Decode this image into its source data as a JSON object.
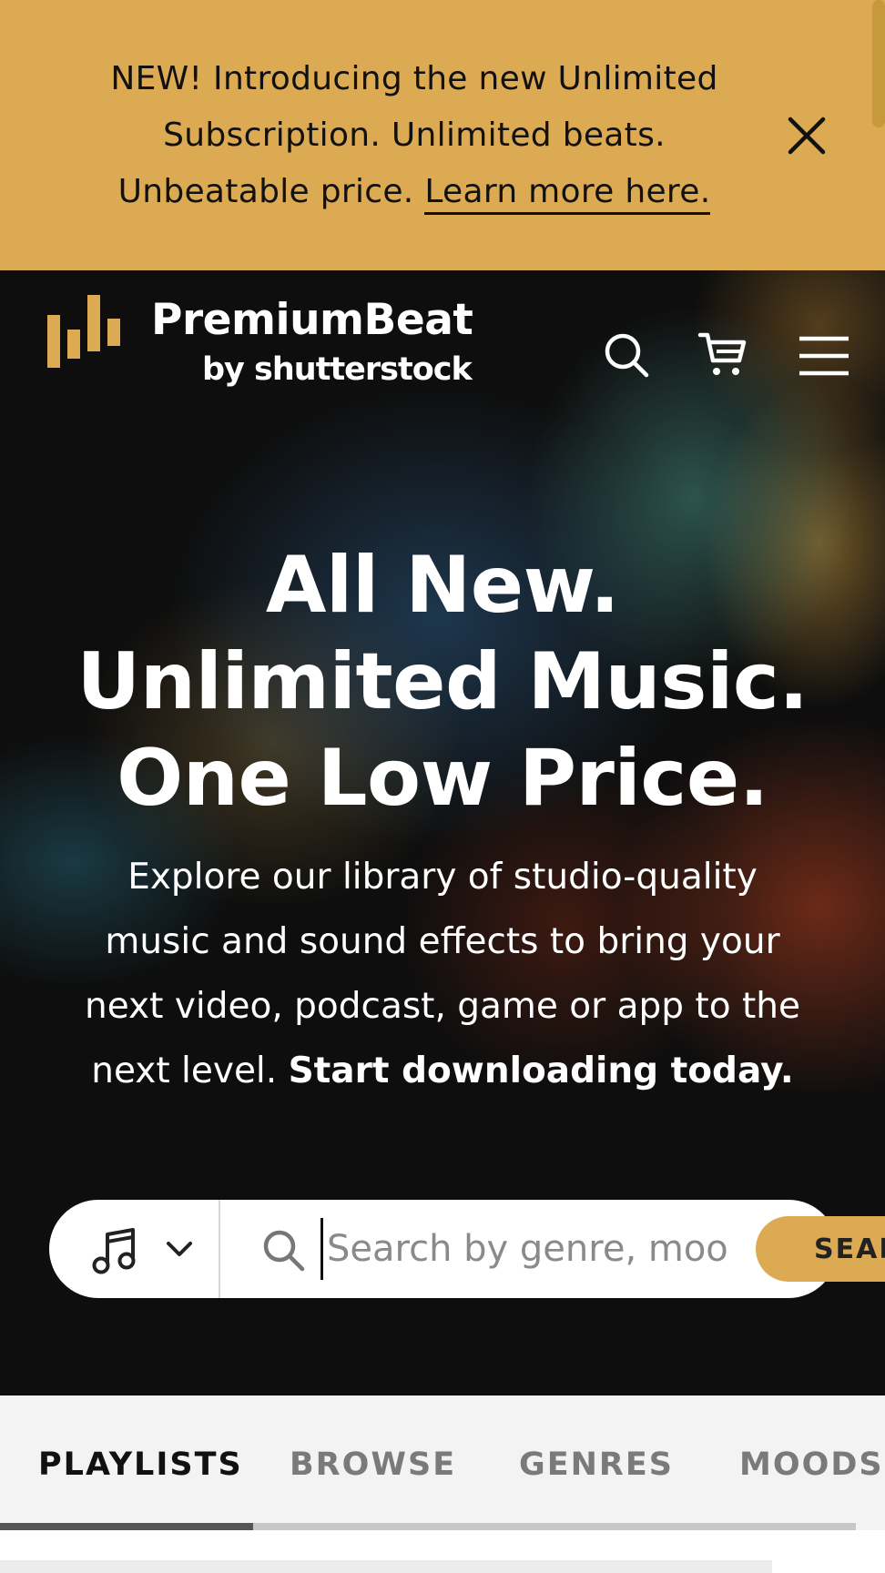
{
  "banner": {
    "text_line1": "NEW! Introducing the new Unlimited",
    "text_line2": "Subscription. Unlimited beats.",
    "text_line3_prefix": "Unbeatable price.",
    "link_label": "Learn more here.",
    "close_icon": "close-icon",
    "background": "#dcaa52"
  },
  "header": {
    "logo_main": "PremiumBeat",
    "logo_sub": "by shutterstock",
    "logo_color": "#dcaa52",
    "icons": [
      "search-icon",
      "cart-icon",
      "menu-icon"
    ]
  },
  "hero": {
    "title_line1": "All New.",
    "title_line2": "Unlimited Music.",
    "title_line3": "One Low Price.",
    "desc_line1": "Explore our library of studio-quality",
    "desc_line2": "music and sound effects to bring your",
    "desc_line3": "next video, podcast, game or app to the",
    "desc_line4_prefix": "next level.",
    "desc_line4_bold": "Start downloading today."
  },
  "search": {
    "type_icon": "music-note-icon",
    "placeholder": "Search by genre, moo",
    "button_label": "SEAR",
    "accent": "#dcaa52"
  },
  "tabs": {
    "items": [
      {
        "label": "PLAYLISTS"
      },
      {
        "label": "BROWSE"
      },
      {
        "label": "GENRES"
      },
      {
        "label": "MOODS"
      }
    ]
  }
}
